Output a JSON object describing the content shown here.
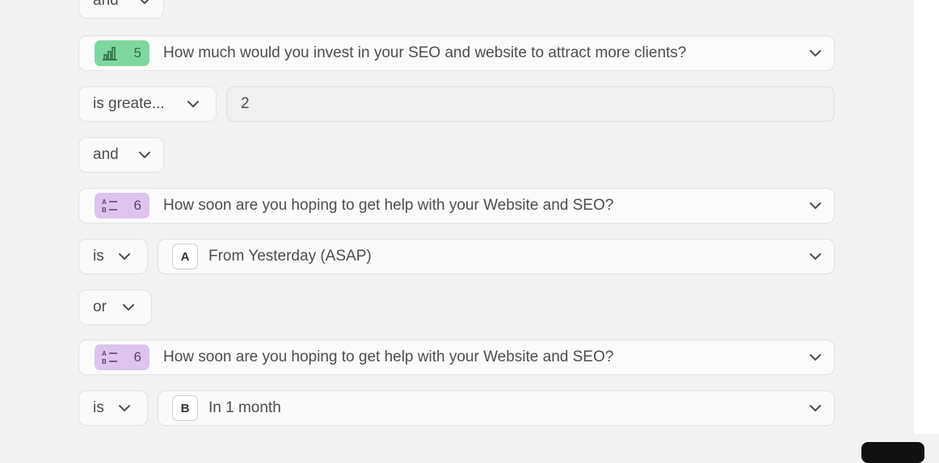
{
  "logic": {
    "and_1": "and",
    "q5": {
      "number": "5",
      "icon": "bar-chart-icon",
      "badge_color": "#7ed7a1",
      "text": "How much would you invest in your SEO and website to attract more clients?"
    },
    "op_q5": "is greate...",
    "value_q5": "2",
    "and_2": "and",
    "q6_a": {
      "number": "6",
      "icon": "multiple-choice-icon",
      "badge_color": "#dcc4ee",
      "text": "How soon are you hoping to get help with your Website and SEO?"
    },
    "op_q6_a": "is",
    "choice_a": {
      "letter": "A",
      "text": "From Yesterday (ASAP)"
    },
    "or_1": "or",
    "q6_b": {
      "number": "6",
      "icon": "multiple-choice-icon",
      "badge_color": "#dcc4ee",
      "text": "How soon are you hoping to get help with your Website and SEO?"
    },
    "op_q6_b": "is",
    "choice_b": {
      "letter": "B",
      "text": "In 1 month"
    }
  }
}
